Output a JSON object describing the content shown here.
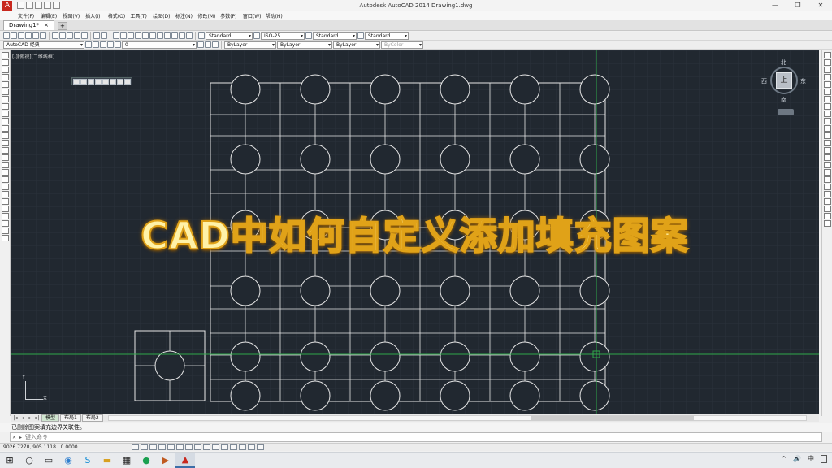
{
  "app": {
    "title": "Autodesk AutoCAD 2014    Drawing1.dwg",
    "icon_letter": "A",
    "window_buttons": [
      "—",
      "❐",
      "✕"
    ]
  },
  "menu": [
    "文件(F)",
    "编辑(E)",
    "视图(V)",
    "插入(I)",
    "格式(O)",
    "工具(T)",
    "绘图(D)",
    "标注(N)",
    "修改(M)",
    "参数(P)",
    "窗口(W)",
    "帮助(H)"
  ],
  "doc_tabs": [
    {
      "label": "Drawing1*",
      "close": "×"
    }
  ],
  "toolbar": {
    "text_style": "Standard",
    "dim_style": "ISO-25",
    "table_style": "Standard",
    "mleader_style": "Standard",
    "workspace": "AutoCAD 经典",
    "layer": "0",
    "color": "ByLayer",
    "linetype": "ByLayer",
    "lineweight": "ByLayer",
    "plotstyle": "ByColor"
  },
  "viewport": {
    "label": "[-][俯视][二维线框]",
    "background": "#212830"
  },
  "viewcube": {
    "north": "北",
    "south": "南",
    "east": "东",
    "west": "西",
    "face": "上"
  },
  "overlay": {
    "headline": "CAD中如何自定义添加填充图案"
  },
  "ucs": {
    "x": "X",
    "y": "Y"
  },
  "layout_tabs": [
    "模型",
    "布局1",
    "布局2"
  ],
  "command": {
    "history": "已删除图案填充边界关联性。",
    "placeholder": "键入命令",
    "close": "✕"
  },
  "status": {
    "coordinates": "9026.7270,  905.1118 ,  0.0000"
  },
  "taskbar": {
    "icons": [
      "windows-start",
      "search",
      "task-view",
      "explorer",
      "browser-360",
      "file-manager",
      "calculator",
      "browser-green",
      "media-player",
      "autocad"
    ],
    "tray": [
      "^",
      "🔊",
      "中"
    ]
  },
  "colors": {
    "crosshair": "#2fa84a",
    "drawing": "#e6e6e6"
  }
}
